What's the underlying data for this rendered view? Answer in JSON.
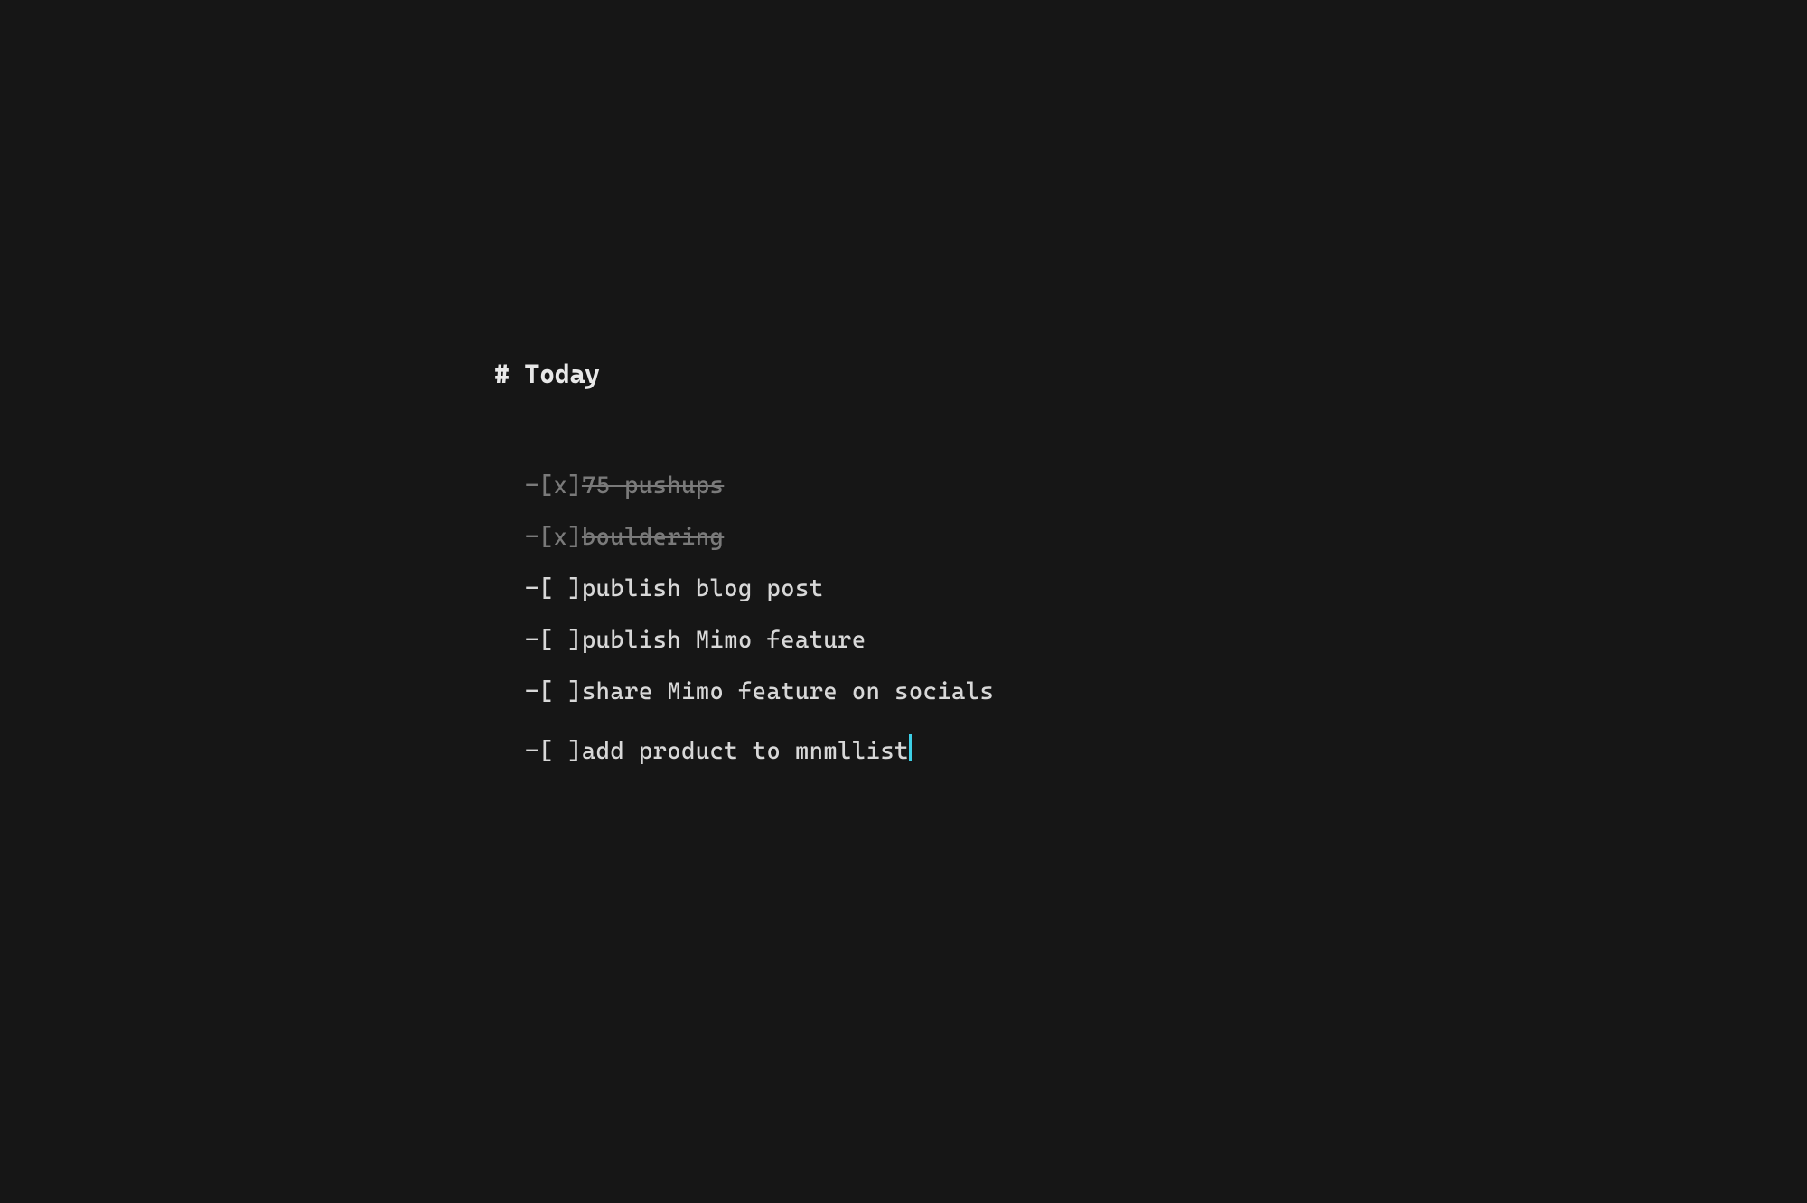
{
  "heading": "# Today",
  "tasks": [
    {
      "marker": "- ",
      "checkbox": "[x] ",
      "text": "75 pushups",
      "done": true,
      "cursor": false
    },
    {
      "marker": "- ",
      "checkbox": "[x] ",
      "text": "bouldering",
      "done": true,
      "cursor": false
    },
    {
      "marker": "- ",
      "checkbox": "[ ] ",
      "text": "publish blog post",
      "done": false,
      "cursor": false
    },
    {
      "marker": "- ",
      "checkbox": "[ ] ",
      "text": "publish Mimo feature",
      "done": false,
      "cursor": false
    },
    {
      "marker": "- ",
      "checkbox": "[ ] ",
      "text": "share Mimo feature on socials",
      "done": false,
      "cursor": false
    },
    {
      "marker": "- ",
      "checkbox": "[ ] ",
      "text": "add product to mnmllist",
      "done": false,
      "cursor": true
    }
  ]
}
